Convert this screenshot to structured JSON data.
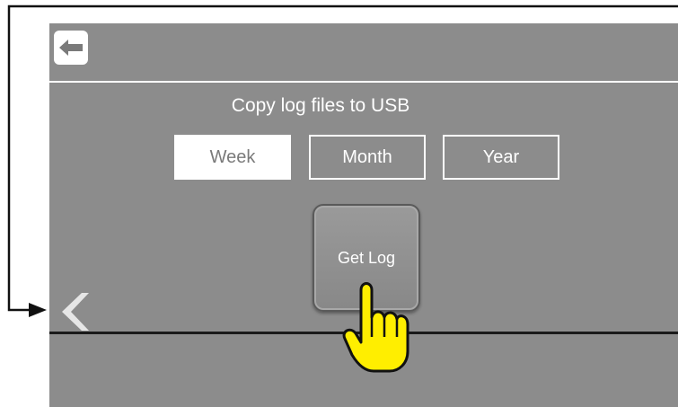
{
  "screen": {
    "title": "Copy log files to USB",
    "tabs": [
      {
        "label": "Week",
        "selected": true
      },
      {
        "label": "Month",
        "selected": false
      },
      {
        "label": "Year",
        "selected": false
      }
    ],
    "get_log_label": "Get Log"
  },
  "icons": {
    "back": "arrow-left-icon",
    "previous": "chevron-left-icon",
    "pointer": "pointing-hand-icon"
  },
  "colors": {
    "screen_background": "#8c8c8c",
    "text": "#ffffff",
    "hand": "#ffff00"
  }
}
